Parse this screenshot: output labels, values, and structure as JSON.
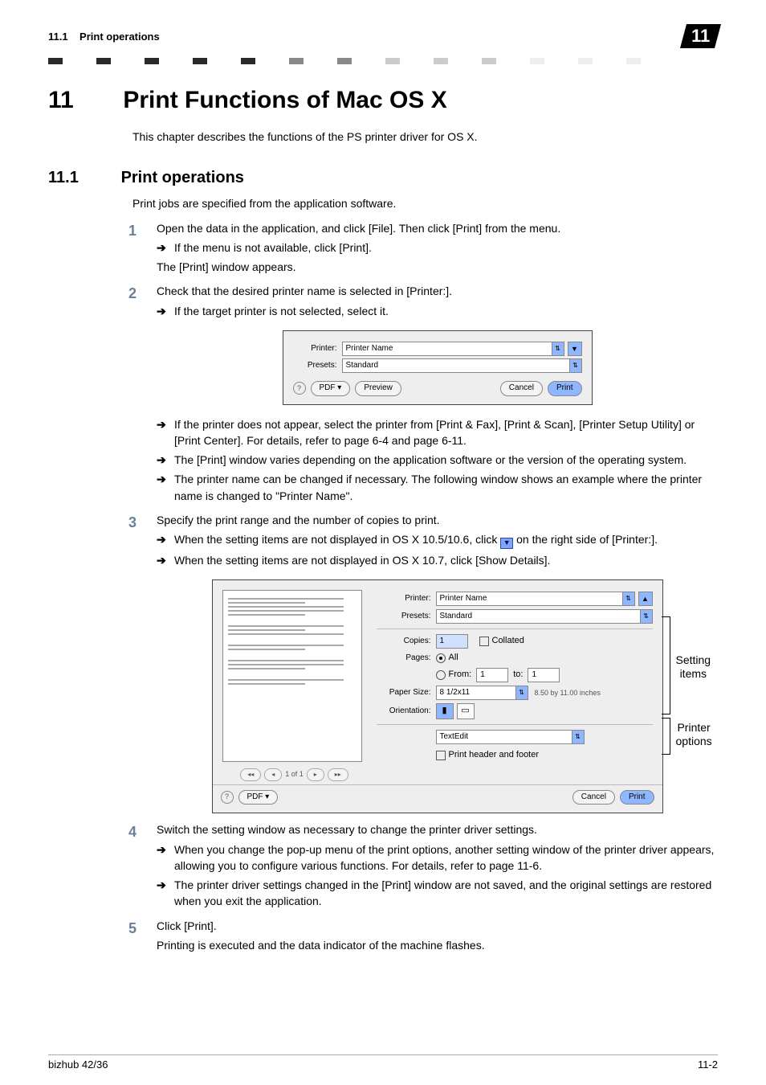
{
  "header": {
    "section_ref": "11.1",
    "section_name": "Print operations",
    "chapter_badge": "11"
  },
  "chapter": {
    "number": "11",
    "title": "Print Functions of Mac OS X",
    "intro": "This chapter describes the functions of the PS printer driver for OS X."
  },
  "section": {
    "number": "11.1",
    "title": "Print operations",
    "intro": "Print jobs are specified from the application software."
  },
  "steps": {
    "s1": {
      "num": "1",
      "text": "Open the data in the application, and click [File]. Then click [Print] from the menu.",
      "sub1": "If the menu is not available, click [Print].",
      "after": "The [Print] window appears."
    },
    "s2": {
      "num": "2",
      "text": "Check that the desired printer name is selected in [Printer:].",
      "sub1": "If the target printer is not selected, select it.",
      "sub2": "If the printer does not appear, select the printer from [Print & Fax], [Print & Scan], [Printer Setup Utility] or [Print Center]. For details, refer to page 6-4 and page 6-11.",
      "sub3": "The [Print] window varies depending on the application software or the version of the operating system.",
      "sub4": "The printer name can be changed if necessary. The following window shows an example where the printer name is changed to \"Printer Name\"."
    },
    "s3": {
      "num": "3",
      "text": "Specify the print range and the number of copies to print.",
      "sub1": "When the setting items are not displayed in OS X 10.5/10.6, click ",
      "sub1_after": " on the right side of [Printer:].",
      "sub2": "When the setting items are not displayed in OS X 10.7, click [Show Details]."
    },
    "s4": {
      "num": "4",
      "text": "Switch the setting window as necessary to change the printer driver settings.",
      "sub1": "When you change the pop-up menu of the print options, another setting window of the printer driver appears, allowing you to configure various functions. For details, refer to page 11-6.",
      "sub2": "The printer driver settings changed in the [Print] window are not saved, and the original settings are restored when you exit the application."
    },
    "s5": {
      "num": "5",
      "text": "Click [Print].",
      "after": "Printing is executed and the data indicator of the machine flashes."
    }
  },
  "dialog_small": {
    "printer_label": "Printer:",
    "printer_value": "Printer Name",
    "presets_label": "Presets:",
    "presets_value": "Standard",
    "help": "?",
    "pdf": "PDF ▾",
    "preview": "Preview",
    "cancel": "Cancel",
    "print": "Print"
  },
  "dialog_big": {
    "printer_label": "Printer:",
    "printer_value": "Printer Name",
    "presets_label": "Presets:",
    "presets_value": "Standard",
    "copies_label": "Copies:",
    "copies_value": "1",
    "collated": "Collated",
    "pages_label": "Pages:",
    "pages_all": "All",
    "pages_from": "From:",
    "pages_from_val": "1",
    "pages_to": "to:",
    "pages_to_val": "1",
    "papersize_label": "Paper Size:",
    "papersize_value": "8 1/2x11",
    "papersize_hint": "8.50 by 11.00 inches",
    "orientation_label": "Orientation:",
    "section_value": "TextEdit",
    "footer_check": "Print header and footer",
    "nav": "1 of 1",
    "help": "?",
    "pdf": "PDF ▾",
    "cancel": "Cancel",
    "print": "Print"
  },
  "annotations": {
    "setting": "Setting items",
    "printer": "Printer options"
  },
  "footer": {
    "product": "bizhub 42/36",
    "page": "11-2"
  }
}
